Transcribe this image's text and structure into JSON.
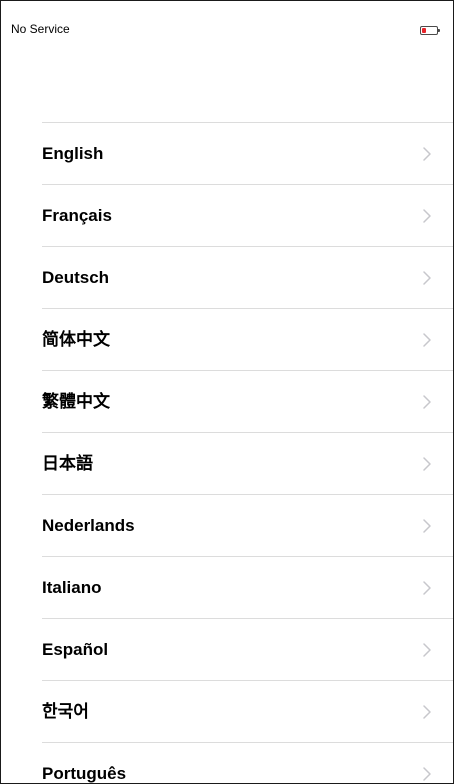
{
  "status_bar": {
    "carrier": "No Service",
    "battery_level": 0.2,
    "battery_color": "#e8232a"
  },
  "languages": [
    {
      "label": "English"
    },
    {
      "label": "Français"
    },
    {
      "label": "Deutsch"
    },
    {
      "label": "简体中文"
    },
    {
      "label": "繁體中文"
    },
    {
      "label": "日本語"
    },
    {
      "label": "Nederlands"
    },
    {
      "label": "Italiano"
    },
    {
      "label": "Español"
    },
    {
      "label": "한국어"
    },
    {
      "label": "Português"
    }
  ],
  "row_icon": "chevron-right-icon"
}
